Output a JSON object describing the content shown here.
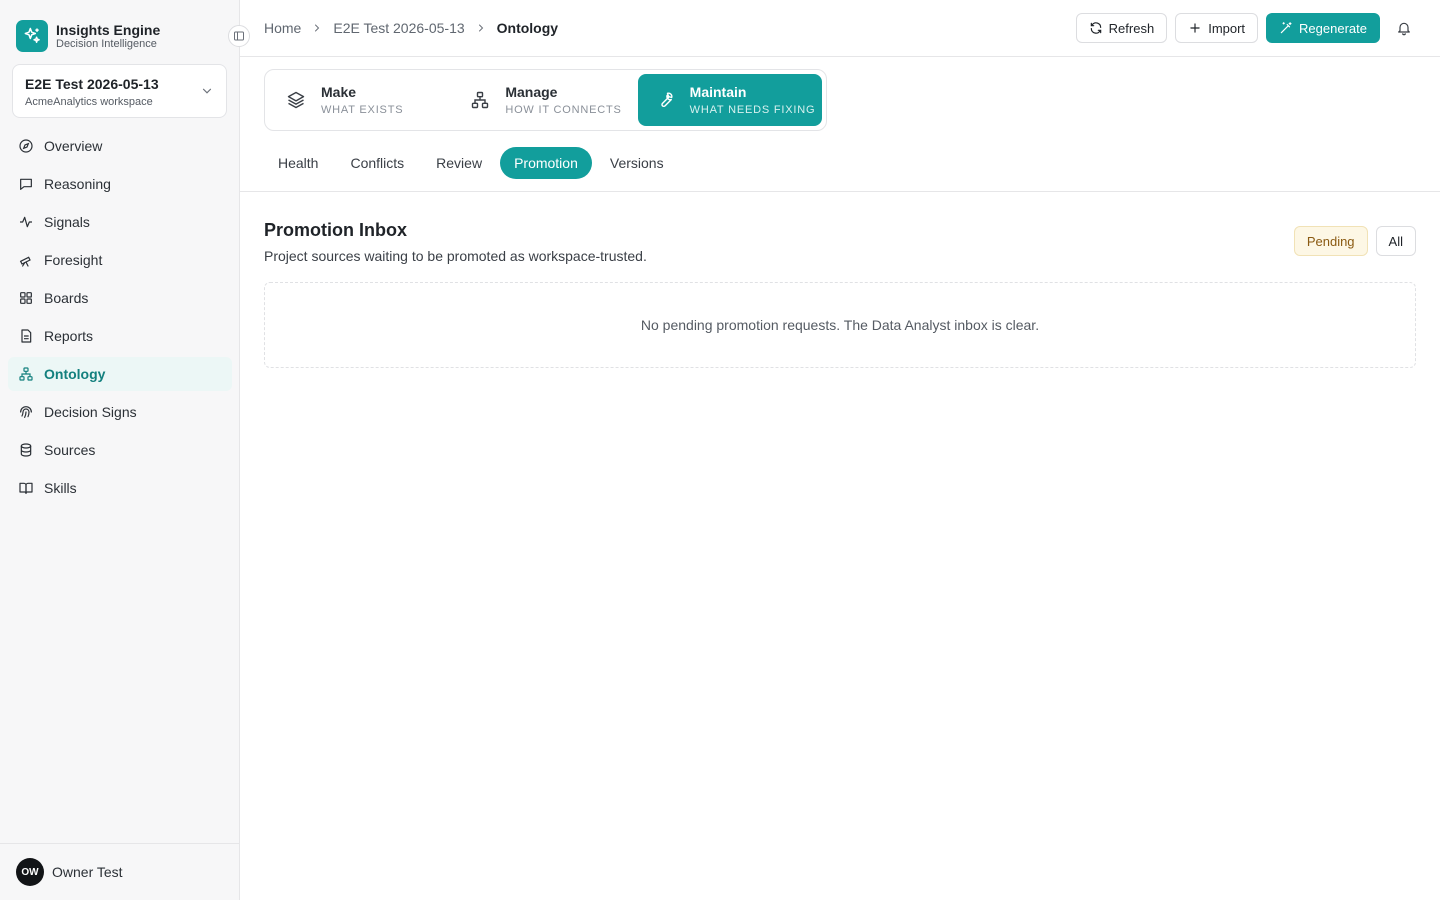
{
  "app": {
    "title": "Insights Engine",
    "subtitle": "Decision Intelligence"
  },
  "workspace": {
    "name": "E2E Test 2026-05-13",
    "subtitle": "AcmeAnalytics workspace"
  },
  "sidebar": {
    "items": [
      {
        "label": "Overview",
        "icon": "compass-icon"
      },
      {
        "label": "Reasoning",
        "icon": "message-icon"
      },
      {
        "label": "Signals",
        "icon": "activity-icon"
      },
      {
        "label": "Foresight",
        "icon": "telescope-icon"
      },
      {
        "label": "Boards",
        "icon": "grid-icon"
      },
      {
        "label": "Reports",
        "icon": "document-icon"
      },
      {
        "label": "Ontology",
        "icon": "network-icon",
        "active": true
      },
      {
        "label": "Decision Signs",
        "icon": "fingerprint-icon"
      },
      {
        "label": "Sources",
        "icon": "database-icon"
      },
      {
        "label": "Skills",
        "icon": "book-icon"
      }
    ]
  },
  "user": {
    "initials": "OW",
    "name": "Owner Test"
  },
  "breadcrumb": {
    "home": "Home",
    "project": "E2E Test 2026-05-13",
    "current": "Ontology"
  },
  "toolbar": {
    "refresh": "Refresh",
    "import": "Import",
    "regenerate": "Regenerate"
  },
  "modes": [
    {
      "title": "Make",
      "subtitle": "WHAT EXISTS",
      "icon": "layers-icon"
    },
    {
      "title": "Manage",
      "subtitle": "HOW IT CONNECTS",
      "icon": "hierarchy-icon"
    },
    {
      "title": "Maintain",
      "subtitle": "WHAT NEEDS FIXING",
      "icon": "wrench-icon",
      "active": true
    }
  ],
  "subtabs": [
    {
      "label": "Health"
    },
    {
      "label": "Conflicts"
    },
    {
      "label": "Review"
    },
    {
      "label": "Promotion",
      "active": true
    },
    {
      "label": "Versions"
    }
  ],
  "section": {
    "title": "Promotion Inbox",
    "description": "Project sources waiting to be promoted as workspace-trusted.",
    "filters": {
      "pending": "Pending",
      "all": "All"
    },
    "empty_message": "No pending promotion requests. The Data Analyst inbox is clear."
  },
  "colors": {
    "accent": "#129e9c",
    "accent_soft": "#ecf7f6",
    "pending_bg": "#fdf7e5"
  }
}
